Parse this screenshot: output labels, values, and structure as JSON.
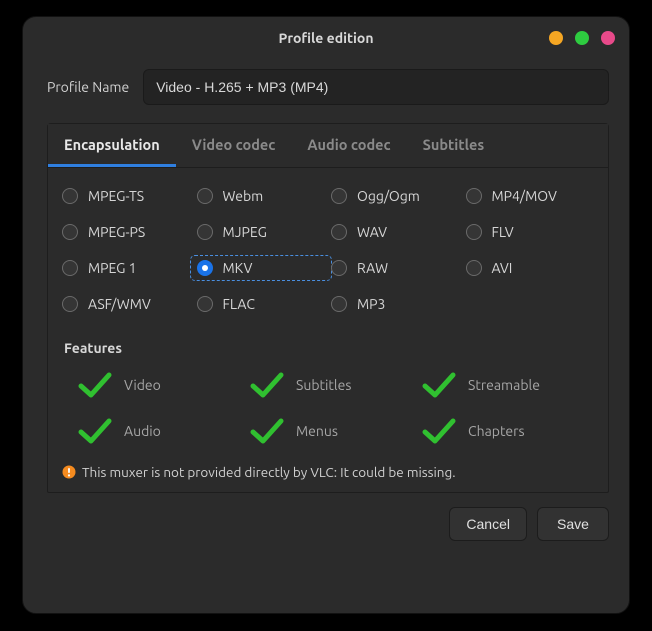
{
  "title": "Profile edition",
  "profile_name_label": "Profile Name",
  "profile_name_value": "Video - H.265 + MP3 (MP4)",
  "tabs": {
    "encapsulation": "Encapsulation",
    "video_codec": "Video codec",
    "audio_codec": "Audio codec",
    "subtitles": "Subtitles"
  },
  "active_tab": "encapsulation",
  "formats": {
    "mpeg_ts": "MPEG-TS",
    "webm": "Webm",
    "ogg": "Ogg/Ogm",
    "mp4": "MP4/MOV",
    "mpeg_ps": "MPEG-PS",
    "mjpeg": "MJPEG",
    "wav": "WAV",
    "flv": "FLV",
    "mpeg1": "MPEG 1",
    "mkv": "MKV",
    "raw": "RAW",
    "avi": "AVI",
    "asf": "ASF/WMV",
    "flac": "FLAC",
    "mp3": "MP3"
  },
  "selected_format": "mkv",
  "features_label": "Features",
  "features": {
    "video": "Video",
    "subtitles": "Subtitles",
    "streamable": "Streamable",
    "audio": "Audio",
    "menus": "Menus",
    "chapters": "Chapters"
  },
  "warning_text": "This muxer is not provided directly by VLC: It could be missing.",
  "buttons": {
    "cancel": "Cancel",
    "save": "Save"
  },
  "colors": {
    "accent": "#1a73e8",
    "check": "#2fbf2f",
    "warn": "#f58b1f"
  }
}
